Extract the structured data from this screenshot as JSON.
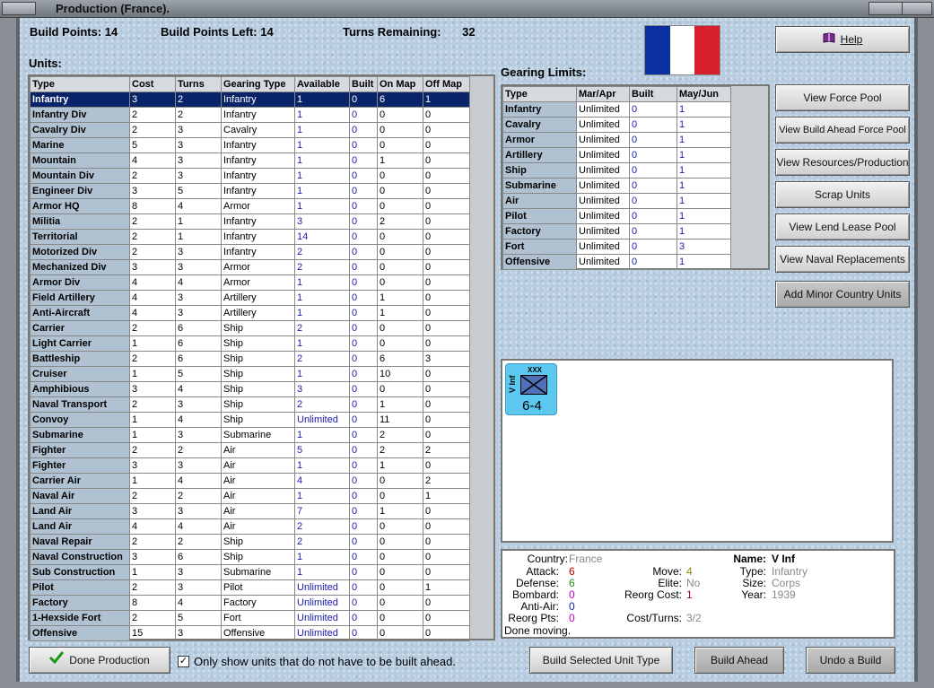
{
  "window": {
    "title": "Production (France)."
  },
  "stats": {
    "build_points_label": "Build Points:",
    "build_points": "14",
    "build_points_left_label": "Build Points Left:",
    "build_points_left": "14",
    "turns_remaining_label": "Turns Remaining:",
    "turns_remaining": "32"
  },
  "units_label": "Units:",
  "units_columns": [
    "Type",
    "Cost",
    "Turns",
    "Gearing Type",
    "Available",
    "Built",
    "On Map",
    "Off Map"
  ],
  "units": [
    [
      "Infantry",
      "3",
      "2",
      "Infantry",
      "1",
      "0",
      "6",
      "1"
    ],
    [
      "Infantry Div",
      "2",
      "2",
      "Infantry",
      "1",
      "0",
      "0",
      "0"
    ],
    [
      "Cavalry Div",
      "2",
      "3",
      "Cavalry",
      "1",
      "0",
      "0",
      "0"
    ],
    [
      "Marine",
      "5",
      "3",
      "Infantry",
      "1",
      "0",
      "0",
      "0"
    ],
    [
      "Mountain",
      "4",
      "3",
      "Infantry",
      "1",
      "0",
      "1",
      "0"
    ],
    [
      "Mountain Div",
      "2",
      "3",
      "Infantry",
      "1",
      "0",
      "0",
      "0"
    ],
    [
      "Engineer Div",
      "3",
      "5",
      "Infantry",
      "1",
      "0",
      "0",
      "0"
    ],
    [
      "Armor HQ",
      "8",
      "4",
      "Armor",
      "1",
      "0",
      "0",
      "0"
    ],
    [
      "Militia",
      "2",
      "1",
      "Infantry",
      "3",
      "0",
      "2",
      "0"
    ],
    [
      "Territorial",
      "2",
      "1",
      "Infantry",
      "14",
      "0",
      "0",
      "0"
    ],
    [
      "Motorized Div",
      "2",
      "3",
      "Infantry",
      "2",
      "0",
      "0",
      "0"
    ],
    [
      "Mechanized Div",
      "3",
      "3",
      "Armor",
      "2",
      "0",
      "0",
      "0"
    ],
    [
      "Armor Div",
      "4",
      "4",
      "Armor",
      "1",
      "0",
      "0",
      "0"
    ],
    [
      "Field Artillery",
      "4",
      "3",
      "Artillery",
      "1",
      "0",
      "1",
      "0"
    ],
    [
      "Anti-Aircraft",
      "4",
      "3",
      "Artillery",
      "1",
      "0",
      "1",
      "0"
    ],
    [
      "Carrier",
      "2",
      "6",
      "Ship",
      "2",
      "0",
      "0",
      "0"
    ],
    [
      "Light Carrier",
      "1",
      "6",
      "Ship",
      "1",
      "0",
      "0",
      "0"
    ],
    [
      "Battleship",
      "2",
      "6",
      "Ship",
      "2",
      "0",
      "6",
      "3"
    ],
    [
      "Cruiser",
      "1",
      "5",
      "Ship",
      "1",
      "0",
      "10",
      "0"
    ],
    [
      "Amphibious",
      "3",
      "4",
      "Ship",
      "3",
      "0",
      "0",
      "0"
    ],
    [
      "Naval Transport",
      "2",
      "3",
      "Ship",
      "2",
      "0",
      "1",
      "0"
    ],
    [
      "Convoy",
      "1",
      "4",
      "Ship",
      "Unlimited",
      "0",
      "11",
      "0"
    ],
    [
      "Submarine",
      "1",
      "3",
      "Submarine",
      "1",
      "0",
      "2",
      "0"
    ],
    [
      "Fighter",
      "2",
      "2",
      "Air",
      "5",
      "0",
      "2",
      "2"
    ],
    [
      "Fighter",
      "3",
      "3",
      "Air",
      "1",
      "0",
      "1",
      "0"
    ],
    [
      "Carrier Air",
      "1",
      "4",
      "Air",
      "4",
      "0",
      "0",
      "2"
    ],
    [
      "Naval Air",
      "2",
      "2",
      "Air",
      "1",
      "0",
      "0",
      "1"
    ],
    [
      "Land Air",
      "3",
      "3",
      "Air",
      "7",
      "0",
      "1",
      "0"
    ],
    [
      "Land Air",
      "4",
      "4",
      "Air",
      "2",
      "0",
      "0",
      "0"
    ],
    [
      "Naval Repair",
      "2",
      "2",
      "Ship",
      "2",
      "0",
      "0",
      "0"
    ],
    [
      "Naval Construction",
      "3",
      "6",
      "Ship",
      "1",
      "0",
      "0",
      "0"
    ],
    [
      "Sub Construction",
      "1",
      "3",
      "Submarine",
      "1",
      "0",
      "0",
      "0"
    ],
    [
      "Pilot",
      "2",
      "3",
      "Pilot",
      "Unlimited",
      "0",
      "0",
      "1"
    ],
    [
      "Factory",
      "8",
      "4",
      "Factory",
      "Unlimited",
      "0",
      "0",
      "0"
    ],
    [
      "1-Hexside Fort",
      "2",
      "5",
      "Fort",
      "Unlimited",
      "0",
      "0",
      "0"
    ],
    [
      "Offensive",
      "15",
      "3",
      "Offensive",
      "Unlimited",
      "0",
      "0",
      "0"
    ]
  ],
  "gearing_label": "Gearing Limits:",
  "gearing_columns": [
    "Type",
    "Mar/Apr",
    "Built",
    "May/Jun"
  ],
  "gearing": [
    [
      "Infantry",
      "Unlimited",
      "0",
      "1"
    ],
    [
      "Cavalry",
      "Unlimited",
      "0",
      "1"
    ],
    [
      "Armor",
      "Unlimited",
      "0",
      "1"
    ],
    [
      "Artillery",
      "Unlimited",
      "0",
      "1"
    ],
    [
      "Ship",
      "Unlimited",
      "0",
      "1"
    ],
    [
      "Submarine",
      "Unlimited",
      "0",
      "1"
    ],
    [
      "Air",
      "Unlimited",
      "0",
      "1"
    ],
    [
      "Pilot",
      "Unlimited",
      "0",
      "1"
    ],
    [
      "Factory",
      "Unlimited",
      "0",
      "1"
    ],
    [
      "Fort",
      "Unlimited",
      "0",
      "3"
    ],
    [
      "Offensive",
      "Unlimited",
      "0",
      "1"
    ]
  ],
  "flag_colors": [
    "#0a2fa0",
    "#ffffff",
    "#d8202c"
  ],
  "buttons": {
    "help": "Help",
    "view_force_pool": "View Force Pool",
    "view_build_ahead": "View Build Ahead Force Pool",
    "view_resources": "View Resources/Production",
    "scrap_units": "Scrap Units",
    "view_lend_lease": "View Lend Lease Pool",
    "view_naval": "View Naval Replacements",
    "add_minor": "Add Minor Country Units",
    "done_production": "Done Production",
    "build_selected": "Build Selected Unit Type",
    "build_ahead": "Build Ahead",
    "undo_build": "Undo a Build"
  },
  "only_show_label": "Only show units that do not have to be built ahead.",
  "counter": {
    "size": "XXX",
    "name": "V Inf",
    "values": "6-4"
  },
  "info": {
    "country_label": "Country:",
    "country": "France",
    "attack_label": "Attack:",
    "attack": "6",
    "defense_label": "Defense:",
    "defense": "6",
    "bombard_label": "Bombard:",
    "bombard": "0",
    "antiair_label": "Anti-Air:",
    "antiair": "0",
    "reorg_pts_label": "Reorg Pts:",
    "reorg_pts": "0",
    "move_label": "Move:",
    "move": "4",
    "elite_label": "Elite:",
    "elite": "No",
    "reorg_cost_label": "Reorg Cost:",
    "reorg_cost": "1",
    "cost_turns_label": "Cost/Turns:",
    "cost_turns": "3/2",
    "name_label": "Name:",
    "name": "V Inf",
    "type_label": "Type:",
    "type": "Infantry",
    "size_label": "Size:",
    "size": "Corps",
    "year_label": "Year:",
    "year": "1939",
    "status": "Done moving."
  }
}
